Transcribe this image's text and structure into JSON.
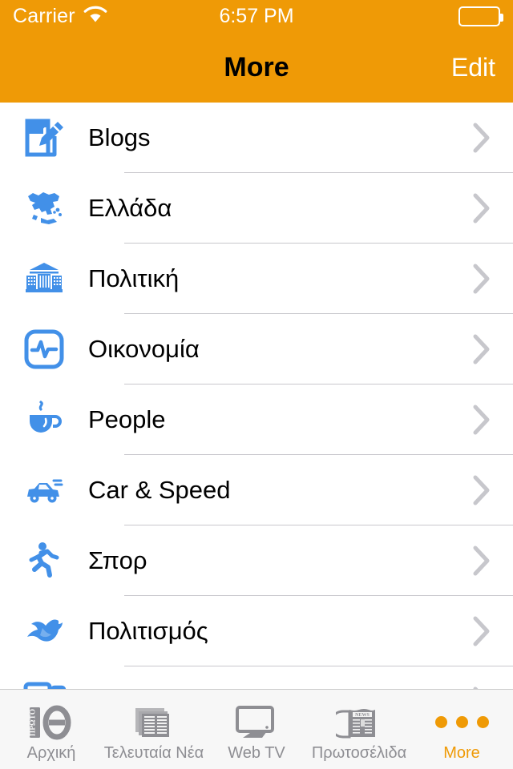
{
  "status_bar": {
    "carrier": "Carrier",
    "wifi_icon": "wifi-icon",
    "time": "6:57 PM",
    "battery_icon": "battery-full-icon"
  },
  "nav_bar": {
    "title": "More",
    "edit_label": "Edit",
    "background_color": "#ef9a06",
    "title_color": "#000000",
    "edit_color": "#ffffff"
  },
  "theme": {
    "accent_orange": "#ef9a06",
    "icon_blue": "#4290e8",
    "separator": "#c8c7cc",
    "chevron": "#c7c7cc",
    "tab_inactive": "#8e8e93",
    "tabbar_bg": "#f7f7f7"
  },
  "list": {
    "rows": [
      {
        "label": "Blogs",
        "icon": "compose-document-pencil-icon",
        "chevron": "chevron-right-icon"
      },
      {
        "label": "Ελλάδα",
        "icon": "greece-map-icon",
        "chevron": "chevron-right-icon"
      },
      {
        "label": "Πολιτική",
        "icon": "parliament-building-icon",
        "chevron": "chevron-right-icon"
      },
      {
        "label": "Οικονομία",
        "icon": "pulse-chart-icon",
        "chevron": "chevron-right-icon"
      },
      {
        "label": "People",
        "icon": "coffee-cup-icon",
        "chevron": "chevron-right-icon"
      },
      {
        "label": "Car & Speed",
        "icon": "car-icon",
        "chevron": "chevron-right-icon"
      },
      {
        "label": "Σπορ",
        "icon": "running-person-icon",
        "chevron": "chevron-right-icon"
      },
      {
        "label": "Πολιτισμός",
        "icon": "dove-bird-icon",
        "chevron": "chevron-right-icon"
      },
      {
        "label": "",
        "icon": "media-screens-icon",
        "chevron": "chevron-right-icon"
      }
    ]
  },
  "tab_bar": {
    "tabs": [
      {
        "label": "Αρχική",
        "icon": "protothema-logo-icon",
        "active": false
      },
      {
        "label": "Τελευταία Νέα",
        "icon": "newspaper-stack-icon",
        "active": false
      },
      {
        "label": "Web TV",
        "icon": "tv-monitor-icon",
        "active": false
      },
      {
        "label": "Πρωτοσέλιδα",
        "icon": "folded-newspaper-icon",
        "active": false
      },
      {
        "label": "More",
        "icon": "three-dots-icon",
        "active": true
      }
    ],
    "protothema_logo_text": "ΠΡΩΤΟ",
    "protothema_logo_glyph": "θ",
    "newspaper_masthead_text": "NEWS"
  }
}
